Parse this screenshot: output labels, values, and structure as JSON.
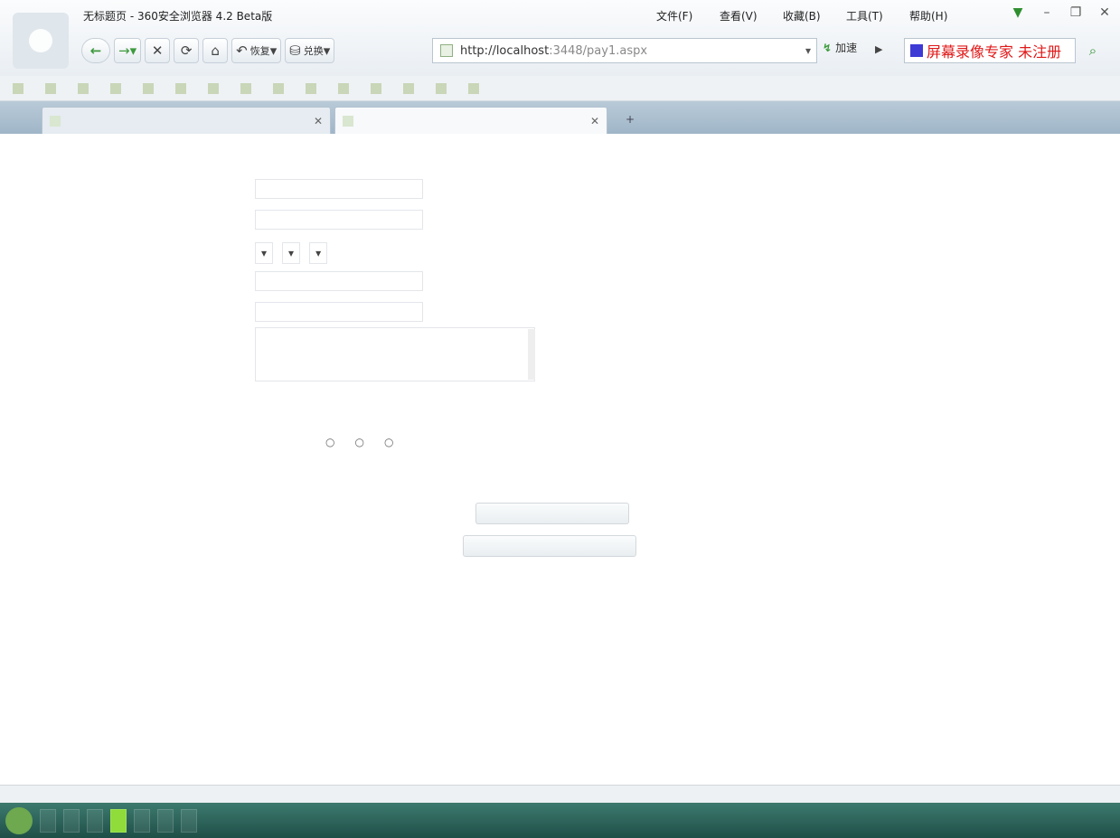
{
  "window": {
    "title": "无标题页 - 360安全浏览器 4.2 Beta版",
    "menus": [
      "文件(F)",
      "查看(V)",
      "收藏(B)",
      "工具(T)",
      "帮助(H)"
    ],
    "controls": [
      "▼",
      "–",
      "❐",
      "✕"
    ]
  },
  "nav": {
    "back": "←",
    "forward": "→",
    "stop": "✕",
    "refresh": "⟳",
    "home": "⌂",
    "undo_label": "恢复",
    "tools_label": "兑换"
  },
  "address": {
    "url_host": "http://localhost",
    "url_rest": ":3448/pay1.aspx",
    "go_label": "加速"
  },
  "search": {
    "watermark": "屏幕录像专家 未注册"
  },
  "favorites": [
    "",
    "",
    "",
    "",
    "",
    "",
    "",
    "",
    "",
    "",
    "",
    "",
    "",
    "",
    ""
  ],
  "tabs": [
    {
      "title": "",
      "close": "✕"
    },
    {
      "title": "",
      "close": "✕"
    }
  ],
  "new_tab": "+",
  "page": {
    "section1": "",
    "section2": "",
    "section3": "",
    "labels": [
      "",
      "",
      "",
      "",
      "",
      ""
    ],
    "hints": [
      "",
      "",
      ""
    ],
    "radios": [
      "",
      "",
      ""
    ],
    "button1": "",
    "button2": "",
    "footer_links": [
      "",
      "",
      "",
      "",
      "",
      "",
      ""
    ],
    "copyright": ""
  },
  "status": {
    "left": "",
    "right": [
      "",
      "",
      ""
    ]
  },
  "taskbar": {
    "items": [
      "",
      "",
      "",
      "",
      "",
      "",
      ""
    ],
    "clock": ""
  },
  "colors": {
    "link": "#5a5db8",
    "watermark": "#e01818",
    "taskbar": "#2d6a5e"
  }
}
